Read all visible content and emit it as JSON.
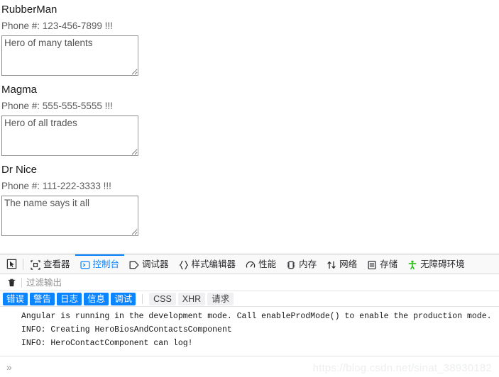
{
  "app": {
    "heroes": [
      {
        "name": "RubberMan",
        "phone": "Phone #: 123-456-7899 !!!",
        "bio": "Hero of many talents"
      },
      {
        "name": "Magma",
        "phone": "Phone #: 555-555-5555 !!!",
        "bio": "Hero of all trades"
      },
      {
        "name": "Dr Nice",
        "phone": "Phone #: 111-222-3333 !!!",
        "bio": "The name says it all"
      }
    ]
  },
  "devtools": {
    "picker_icon": "element-picker-icon",
    "tabs": [
      {
        "label": "查看器",
        "icon": "inspector-icon",
        "active": false
      },
      {
        "label": "控制台",
        "icon": "console-icon",
        "active": true
      },
      {
        "label": "调试器",
        "icon": "debugger-icon",
        "active": false
      },
      {
        "label": "样式编辑器",
        "icon": "style-editor-icon",
        "active": false
      },
      {
        "label": "性能",
        "icon": "performance-icon",
        "active": false
      },
      {
        "label": "内存",
        "icon": "memory-icon",
        "active": false
      },
      {
        "label": "网络",
        "icon": "network-icon",
        "active": false
      },
      {
        "label": "存储",
        "icon": "storage-icon",
        "active": false
      },
      {
        "label": "无障碍环境",
        "icon": "accessibility-icon",
        "active": false
      }
    ],
    "filter": {
      "trash_icon": "trash-icon",
      "placeholder": "过滤输出",
      "value": ""
    },
    "severity": {
      "pills": [
        "错误",
        "警告",
        "日志",
        "信息",
        "调试"
      ],
      "types": [
        "CSS",
        "XHR",
        "请求"
      ]
    },
    "messages": [
      "Angular is running in the development mode. Call enableProdMode() to enable the production mode.",
      "INFO: Creating HeroBiosAndContactsComponent",
      "INFO: HeroContactComponent can log!"
    ],
    "prompt": {
      "chevron": "»",
      "value": ""
    },
    "colors": {
      "accent": "#0a84ff",
      "accessibility": "#2ac214",
      "toolbar_bg": "#f9f9fa"
    }
  },
  "watermark": "https://blog.csdn.net/sinat_38930182"
}
